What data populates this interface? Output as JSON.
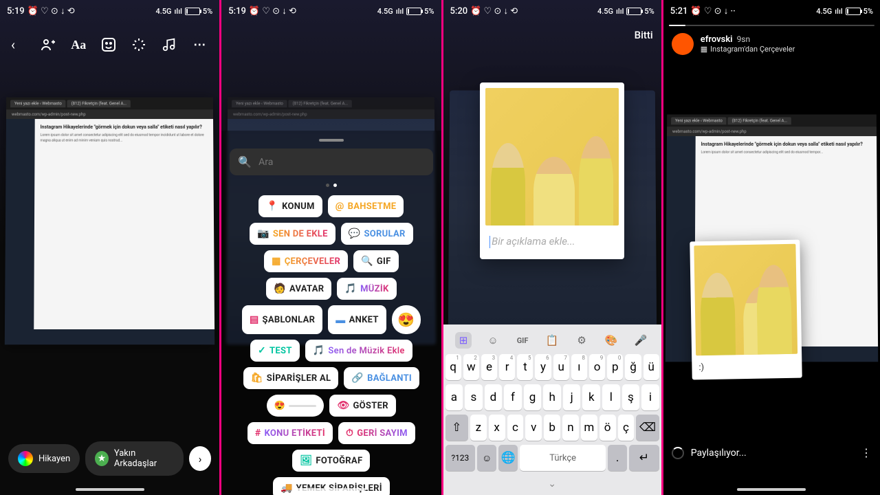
{
  "status": {
    "times": [
      "5:19",
      "5:19",
      "5:20",
      "5:21"
    ],
    "net": "4.5G",
    "sig": "ılıl",
    "bat": "5%"
  },
  "p1": {
    "bottom": {
      "your_story": "Hikayen",
      "close_friends": "Yakın Arkadaşlar"
    }
  },
  "p2": {
    "search_placeholder": "Ara",
    "stickers": {
      "konum": "KONUM",
      "bahsetme": "BAHSETME",
      "sendeekle": "SEN DE EKLE",
      "sorular": "SORULAR",
      "cerceveler": "ÇERÇEVELER",
      "gif": "GIF",
      "avatar": "AVATAR",
      "muzik": "MÜZİK",
      "sablonlar": "ŞABLONLAR",
      "anket": "ANKET",
      "test": "TEST",
      "sendemuzik": "Sen de Müzik Ekle",
      "siparisler": "SİPARİŞLER AL",
      "baglanti": "BAĞLANTI",
      "goster": "GÖSTER",
      "konuetiketi": "KONU ETİKETİ",
      "gerisayim": "GERİ SAYIM",
      "fotograf": "FOTOĞRAF",
      "yemeksiparisleri": "YEMEK SİPARİŞLERİ"
    }
  },
  "p3": {
    "done": "Bitti",
    "caption_placeholder": "Bir açıklama ekle...",
    "gif": "GIF",
    "keys": {
      "row1": [
        "q",
        "w",
        "e",
        "r",
        "t",
        "y",
        "u",
        "ı",
        "o",
        "p",
        "ğ",
        "ü"
      ],
      "nums1": [
        "1",
        "2",
        "3",
        "4",
        "5",
        "6",
        "7",
        "8",
        "9",
        "0",
        "",
        ""
      ],
      "row2": [
        "a",
        "s",
        "d",
        "f",
        "g",
        "h",
        "j",
        "k",
        "l",
        "ş",
        "i"
      ],
      "row3": [
        "z",
        "x",
        "c",
        "v",
        "b",
        "n",
        "m",
        "ö",
        "ç"
      ],
      "sym": "?123",
      "space": "Türkçe"
    }
  },
  "p4": {
    "username": "efrovski",
    "time": "9sn",
    "source": "Instagram'dan Çerçeveler",
    "caption": ":)",
    "sharing": "Paylaşılıyor..."
  },
  "laptop": {
    "tab1": "Yeni yazı ekle ‹ Webmasto",
    "tab2": "(812) Fikretçin (feat. Genel A...",
    "url": "webmasto.com/wp-admin/post-new.php",
    "title": "Instagram Hikayelerinde \"görmek için dokun veya salla\" etiketi nasıl yapılır?"
  }
}
